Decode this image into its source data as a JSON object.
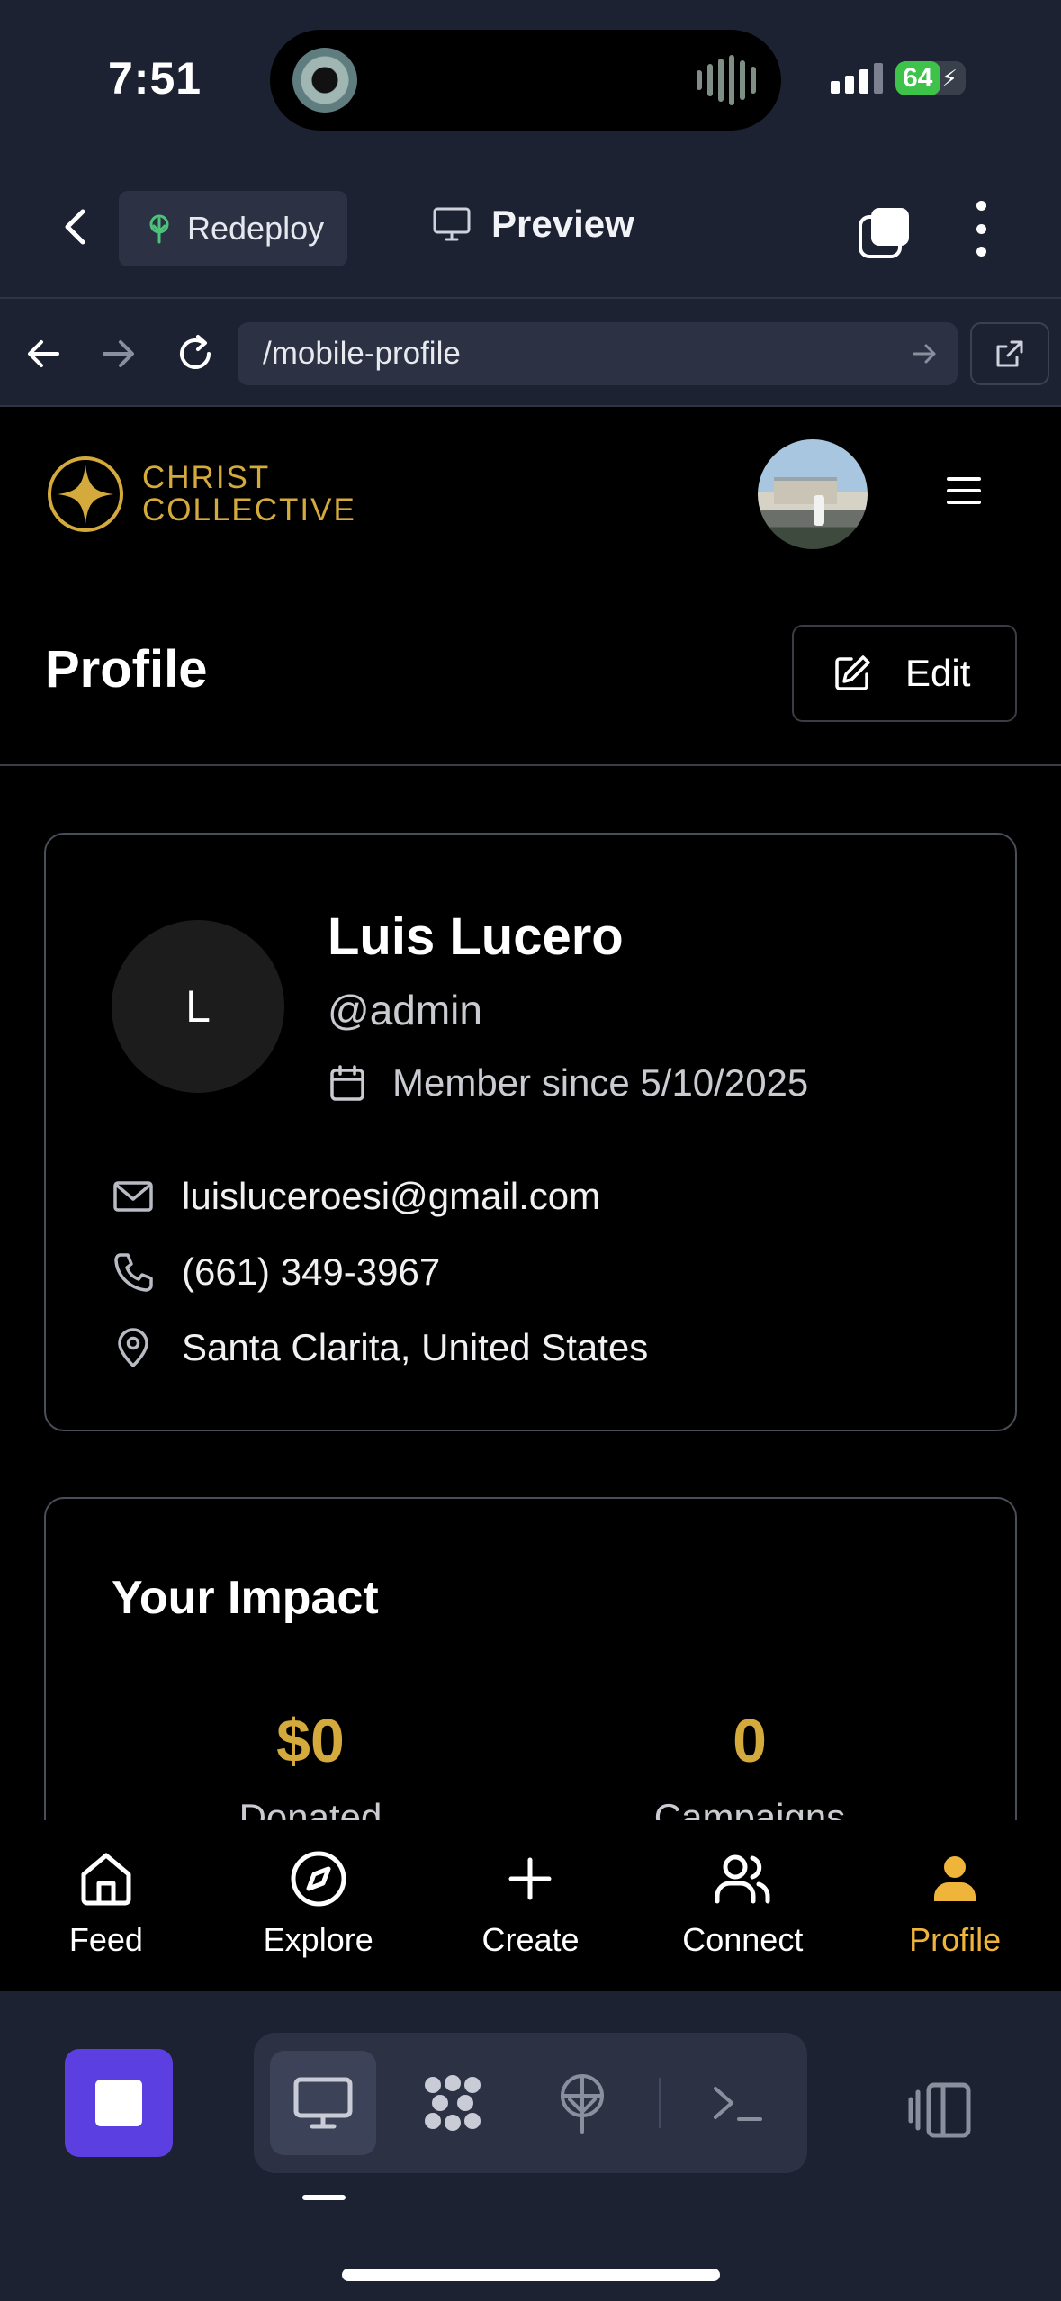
{
  "status_bar": {
    "time": "7:51",
    "battery": "64",
    "battery_level": 0.64
  },
  "app_bar": {
    "redeploy_label": "Redeploy",
    "preview_label": "Preview"
  },
  "browser": {
    "url": "/mobile-profile"
  },
  "site": {
    "logo_line1": "CHRIST",
    "logo_line2": "COLLECTIVE"
  },
  "page": {
    "title": "Profile",
    "edit_label": "Edit"
  },
  "profile": {
    "initial": "L",
    "name": "Luis Lucero",
    "handle": "@admin",
    "member_since": "Member since 5/10/2025",
    "email": "luisluceroesi@gmail.com",
    "phone": "(661) 349-3967",
    "location": "Santa Clarita, United States"
  },
  "impact": {
    "title": "Your Impact",
    "stats": [
      {
        "value": "$0",
        "label": "Donated"
      },
      {
        "value": "0",
        "label": "Campaigns"
      }
    ]
  },
  "bottom_nav": {
    "items": [
      {
        "label": "Feed",
        "icon": "home-icon"
      },
      {
        "label": "Explore",
        "icon": "compass-icon"
      },
      {
        "label": "Create",
        "icon": "plus-icon"
      },
      {
        "label": "Connect",
        "icon": "users-icon"
      },
      {
        "label": "Profile",
        "icon": "user-icon"
      }
    ],
    "active": "Profile",
    "active_color": "#efb43a"
  },
  "colors": {
    "accent_gold": "#d4aa3c",
    "dock_stop": "#5b3fe0",
    "chrome_bg": "#1d2233"
  }
}
